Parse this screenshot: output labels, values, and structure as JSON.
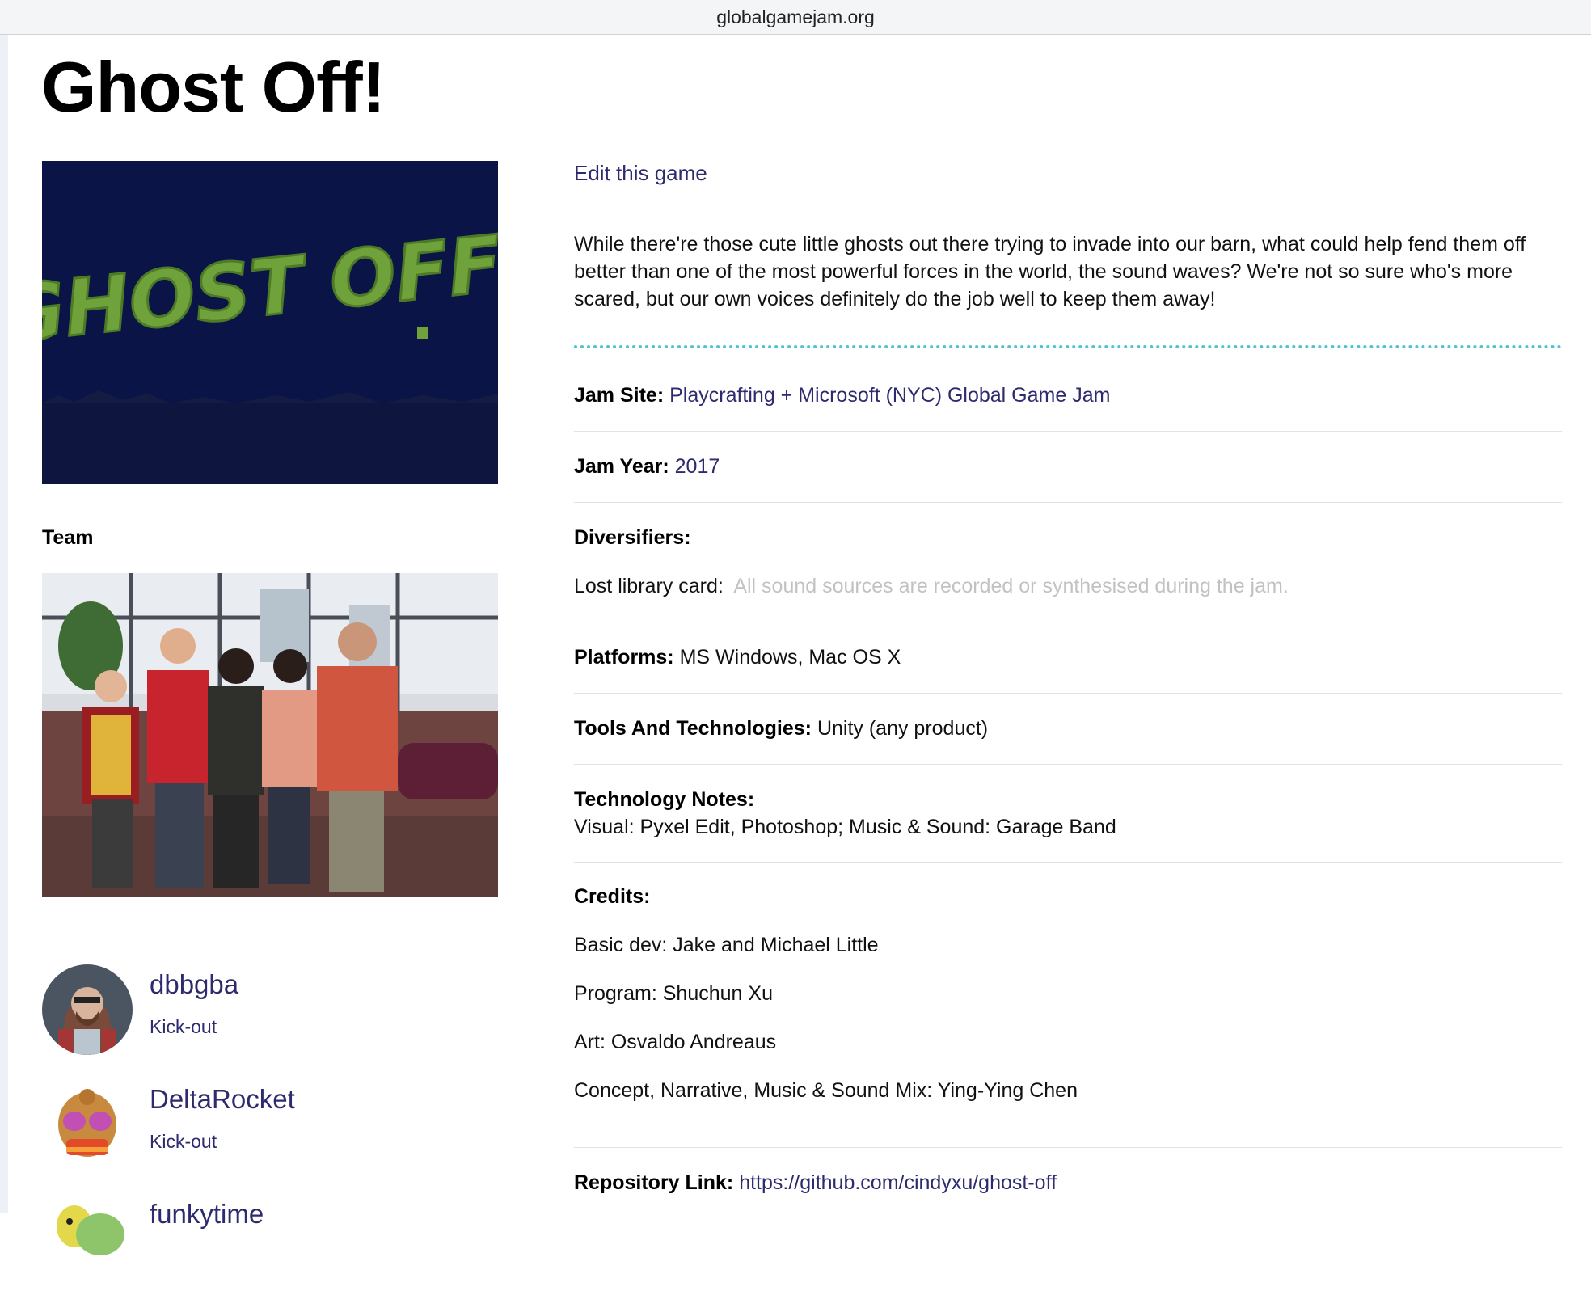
{
  "browser": {
    "url": "globalgamejam.org"
  },
  "game": {
    "title": "Ghost Off!",
    "edit_link": "Edit this game",
    "description": "While there're those cute little ghosts out there trying to invade into our barn, what could help fend them off better than one of the most powerful forces in the world, the sound waves? We're not so sure who's more scared, but our own voices definitely do the job well to keep them away!"
  },
  "cover_art": {
    "text": "GHOST OFF!",
    "text_color": "#6fa23a",
    "bg_color": "#0b1447"
  },
  "team": {
    "heading": "Team",
    "members": [
      {
        "name": "dbbgba",
        "role": "Kick-out"
      },
      {
        "name": "DeltaRocket",
        "role": "Kick-out"
      },
      {
        "name": "funkytime",
        "role": ""
      }
    ]
  },
  "details": {
    "jam_site_label": "Jam Site:",
    "jam_site_value": "Playcrafting + Microsoft (NYC) Global Game Jam",
    "jam_year_label": "Jam Year:",
    "jam_year_value": "2017",
    "diversifiers_label": "Diversifiers:",
    "diversifier_name": "Lost library card:",
    "diversifier_desc": "All sound sources are recorded or synthesised during the jam.",
    "platforms_label": "Platforms:",
    "platforms_value": "MS Windows, Mac OS X",
    "tools_label": "Tools And Technologies:",
    "tools_value": "Unity (any product)",
    "tech_notes_label": "Technology Notes:",
    "tech_notes_value": "Visual: Pyxel Edit, Photoshop; Music & Sound: Garage Band",
    "credits_label": "Credits:",
    "credits": [
      "Basic dev: Jake and Michael Little",
      "Program: Shuchun Xu",
      "Art: Osvaldo Andreaus",
      "Concept, Narrative, Music & Sound Mix: Ying-Ying Chen"
    ],
    "repo_label": "Repository Link:",
    "repo_value": "https://github.com/cindyxu/ghost-off"
  },
  "colors": {
    "link": "#2d2a6e",
    "accent_dotted": "#4fc3d1",
    "muted": "#c2c2c2"
  }
}
